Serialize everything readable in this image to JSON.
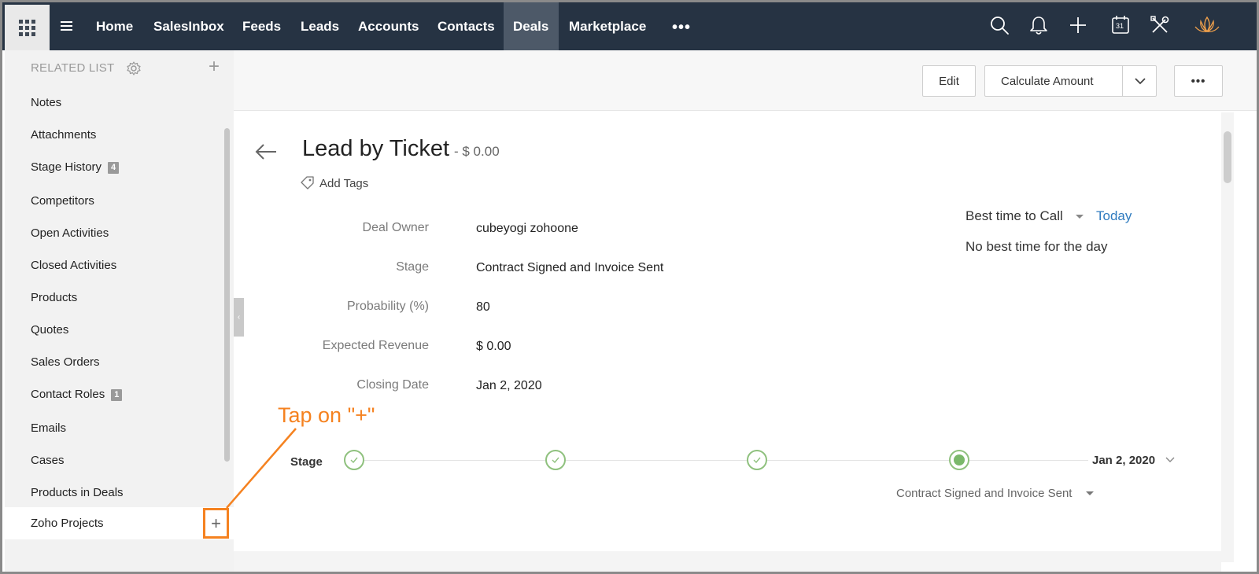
{
  "topnav": {
    "items": [
      {
        "label": "Home"
      },
      {
        "label": "SalesInbox"
      },
      {
        "label": "Feeds"
      },
      {
        "label": "Leads"
      },
      {
        "label": "Accounts"
      },
      {
        "label": "Contacts"
      },
      {
        "label": "Deals",
        "active": true
      },
      {
        "label": "Marketplace"
      }
    ],
    "more": "•••",
    "icons": [
      "search-icon",
      "bell-icon",
      "plus-icon",
      "calendar-icon",
      "tools-icon",
      "lotus-logo-icon"
    ],
    "calendar_day": "31"
  },
  "sidebar": {
    "header": "RELATED LIST",
    "items": [
      {
        "label": "Notes"
      },
      {
        "label": "Attachments"
      },
      {
        "label": "Stage History",
        "badge": "4"
      },
      {
        "label": "Competitors"
      },
      {
        "label": "Open Activities"
      },
      {
        "label": "Closed Activities"
      },
      {
        "label": "Products"
      },
      {
        "label": "Quotes"
      },
      {
        "label": "Sales Orders"
      },
      {
        "label": "Contact Roles",
        "badge": "1"
      },
      {
        "label": "Emails"
      },
      {
        "label": "Cases"
      },
      {
        "label": "Products in Deals"
      },
      {
        "label": "Zoho Projects"
      }
    ],
    "add_symbol": "+"
  },
  "toolbar": {
    "edit_label": "Edit",
    "calculate_label": "Calculate Amount",
    "more_label": "•••"
  },
  "record": {
    "title": "Lead by Ticket",
    "amount": "- $ 0.00",
    "add_tags": "Add Tags",
    "fields": [
      {
        "label": "Deal Owner",
        "value": "cubeyogi zohoone"
      },
      {
        "label": "Stage",
        "value": "Contract Signed and Invoice Sent"
      },
      {
        "label": "Probability (%)",
        "value": "80"
      },
      {
        "label": "Expected Revenue",
        "value": "$ 0.00"
      },
      {
        "label": "Closing Date",
        "value": "Jan 2, 2020"
      }
    ]
  },
  "best_time": {
    "label": "Best time to Call",
    "today": "Today",
    "none": "No best time for the day"
  },
  "stage_bar": {
    "label": "Stage",
    "completed_steps": 3,
    "current_step": 4,
    "date": "Jan 2, 2020",
    "current_name": "Contract Signed and Invoice Sent"
  },
  "annotation": {
    "text": "Tap on \"+\"",
    "color": "#f58220"
  },
  "colors": {
    "nav_bg": "#263343",
    "accent_link": "#2f7bbf",
    "stage_green": "#7ab86a",
    "annotation": "#f58220"
  }
}
